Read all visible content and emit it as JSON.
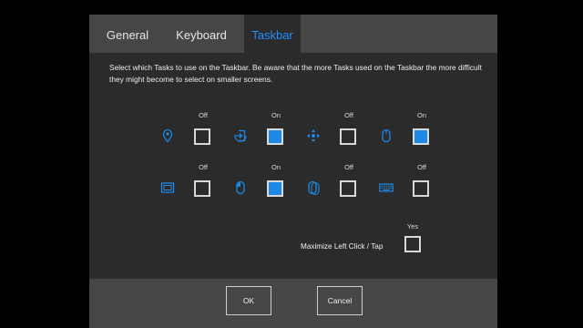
{
  "tabs": [
    {
      "label": "General",
      "active": false
    },
    {
      "label": "Keyboard",
      "active": false
    },
    {
      "label": "Taskbar",
      "active": true
    }
  ],
  "description": "Select which Tasks to use on the Taskbar. Be aware that the more Tasks used on the Taskbar the more difficult they might become to select on smaller screens.",
  "tasks": [
    {
      "icon": "location-pin-icon",
      "state": "Off",
      "checked": false
    },
    {
      "icon": "sign-in-icon",
      "state": "On",
      "checked": true
    },
    {
      "icon": "move-arrows-icon",
      "state": "Off",
      "checked": false
    },
    {
      "icon": "mouse-icon",
      "state": "On",
      "checked": true
    },
    {
      "icon": "screen-capture-icon",
      "state": "Off",
      "checked": false
    },
    {
      "icon": "mouse-left-click-icon",
      "state": "On",
      "checked": true
    },
    {
      "icon": "mouse-right-click-icon",
      "state": "Off",
      "checked": false
    },
    {
      "icon": "keyboard-icon",
      "state": "Off",
      "checked": false
    }
  ],
  "maximize": {
    "label": "Maximize Left Click / Tap",
    "state": "Yes",
    "checked": true
  },
  "buttons": {
    "ok": "OK",
    "cancel": "Cancel"
  },
  "colors": {
    "accent": "#1e88e5",
    "tab_active_text": "#1e90ff",
    "panel": "#2b2b2b",
    "bar": "#464646"
  }
}
